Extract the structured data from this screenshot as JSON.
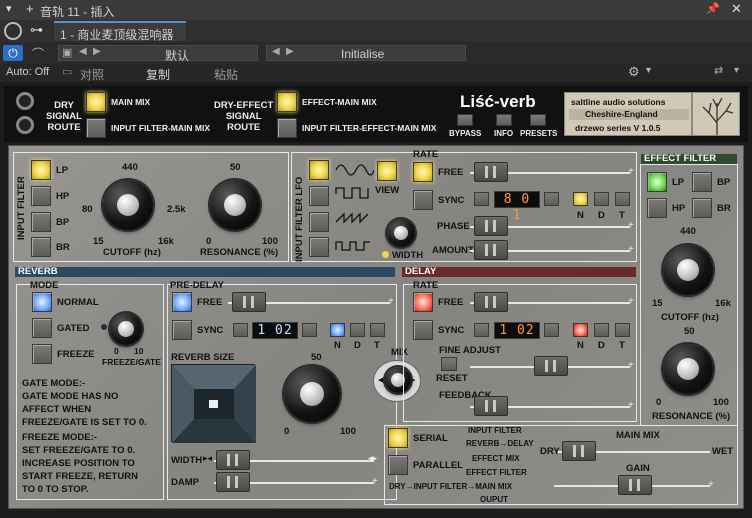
{
  "host": {
    "window_title": "音轨 11 - 插入",
    "slot_label": "1 - 商业麦顶级混响器",
    "preset_name": "默认",
    "preset_state": "Initialise",
    "auto_label": "Auto: Off",
    "compare_label": "对照",
    "copy_label": "复制",
    "paste_label": "粘贴"
  },
  "header": {
    "dry_signal_route": "DRY\nSIGNAL\nROUTE",
    "main_mix": "MAIN MIX",
    "input_filter_main_mix": "INPUT FILTER-MAIN MIX",
    "dry_effect_signal_route": "DRY-EFFECT\nSIGNAL\nROUTE",
    "effect_main_mix": "EFFECT-MAIN MIX",
    "input_filter_effect_main_mix": "INPUT FILTER-EFFECT-MAIN MIX",
    "product_name": "Liść-verb",
    "bypass": "BYPASS",
    "info": "INFO",
    "presets": "PRESETS",
    "vendor_line1": "saltline audio solutions",
    "vendor_line2": "Cheshire-England",
    "vendor_line3": "drzewo series V 1.0.5"
  },
  "input_filter": {
    "title": "INPUT FILTER",
    "lp": "LP",
    "hp": "HP",
    "bp": "BP",
    "br": "BR",
    "cutoff_label": "CUTOFF (hz)",
    "cutoff_ticks": {
      "top": "440",
      "left": "80",
      "right": "2.5k",
      "bl": "15",
      "br": "16k"
    },
    "resonance_label": "RESONANCE (%)",
    "res_ticks": {
      "top": "50",
      "bl": "0",
      "br": "100"
    }
  },
  "lfo": {
    "title": "INPUT FILTER LFO",
    "view": "VIEW",
    "width": "WIDTH",
    "rate": "RATE",
    "free": "FREE",
    "sync": "SYNC",
    "sync_value": "8 0 1",
    "phase": "PHASE",
    "amount": "AMOUNT",
    "n": "N",
    "d": "D",
    "t": "T"
  },
  "effect_filter": {
    "title": "EFFECT FILTER",
    "lp": "LP",
    "hp": "HP",
    "bp": "BP",
    "br": "BR",
    "cutoff_top": "440",
    "cutoff_bl": "15",
    "cutoff_br": "16k",
    "cutoff_label": "CUTOFF (hz)",
    "res_top": "50",
    "res_bl": "0",
    "res_br": "100",
    "resonance_label": "RESONANCE (%)"
  },
  "reverb": {
    "title": "REVERB",
    "mode": "MODE",
    "normal": "NORMAL",
    "gated": "GATED",
    "freeze": "FREEZE",
    "fg_label": "FREEZE/GATE",
    "fg_min": "0",
    "fg_max": "10",
    "pre_delay": "PRE-DELAY",
    "free": "FREE",
    "sync": "SYNC",
    "sync_value": "1 02",
    "n": "N",
    "d": "D",
    "t": "T",
    "size_label": "REVERB SIZE",
    "size_top": "50",
    "size_bl": "0",
    "size_br": "100",
    "gate_text": "GATE MODE:-\nGATE MODE HAS NO\nAFFECT WHEN\nFREEZE/GATE IS SET TO 0.",
    "freeze_text": "FREEZE MODE:-\nSET FREEZE/GATE TO 0.\nINCREASE POSITION TO\nSTART FREEZE, RETURN\nTO 0 TO STOP.",
    "width": "WIDTH",
    "damp": "DAMP"
  },
  "mix": {
    "label": "MIX"
  },
  "delay": {
    "title": "DELAY",
    "rate": "RATE",
    "free": "FREE",
    "sync": "SYNC",
    "sync_value": "1 02",
    "n": "N",
    "d": "D",
    "t": "T",
    "fine_adjust": "FINE ADJUST",
    "reset": "RESET",
    "feedback": "FEEDBACK"
  },
  "routing": {
    "serial": "SERIAL",
    "parallel": "PARALLEL",
    "serial_desc1": "INPUT FILTER",
    "serial_desc2": "REVERB→DELAY",
    "serial_desc3": "EFFECT MIX",
    "par_desc1": "EFFECT FILTER",
    "par_desc2": "DRY→INPUT FILTER→MAIN MIX",
    "par_desc3": "OUPUT",
    "main_mix": "MAIN MIX",
    "dry": "DRY",
    "wet": "WET",
    "gain": "GAIN"
  },
  "colors": {
    "yellow_on": "#f1d54a",
    "reverb_bar": "#2d4a63",
    "delay_bar": "#6b2a2a",
    "effect_bar": "#2f4a2f"
  }
}
